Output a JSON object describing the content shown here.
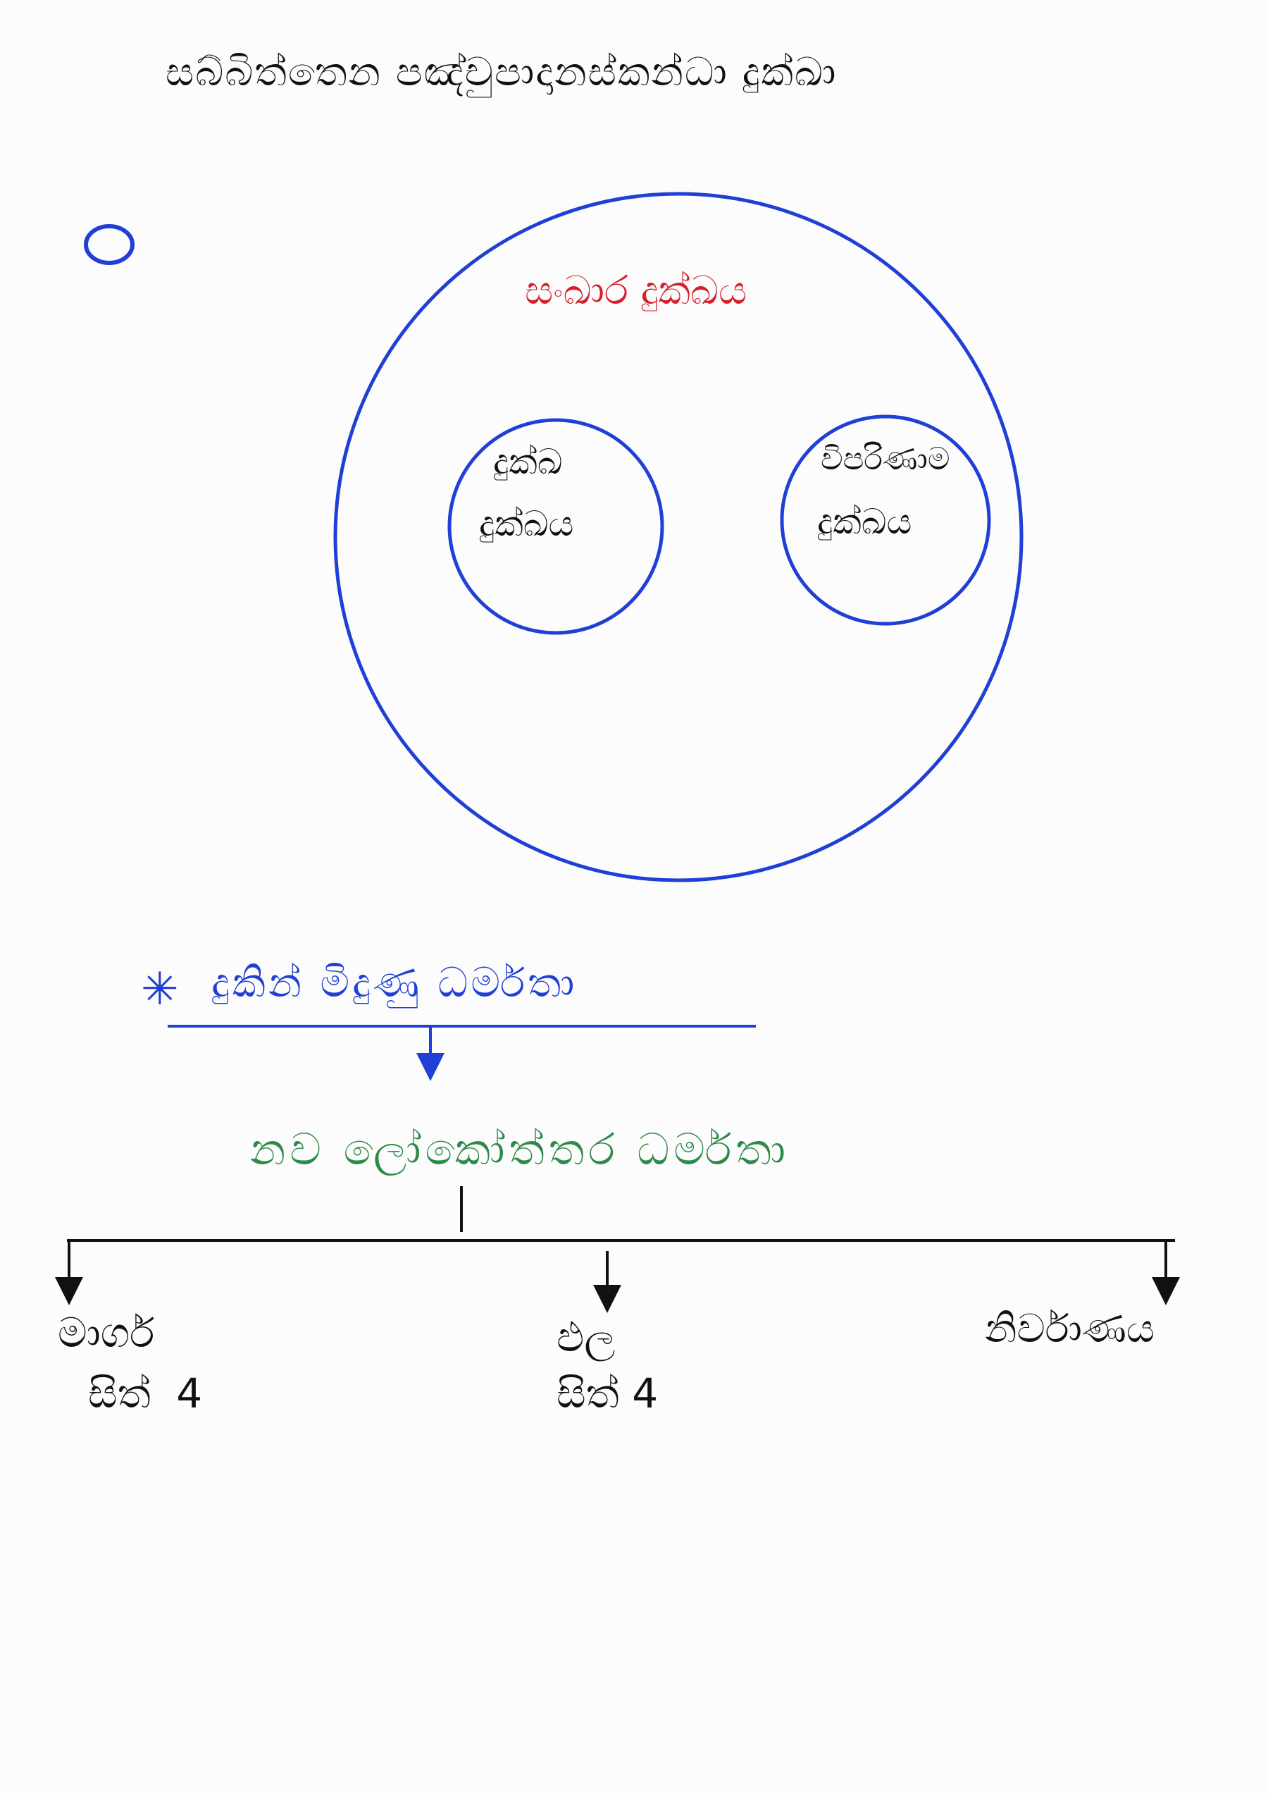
{
  "title": "සබ්බිත්තෙන පඤ්චුපාදානස්කන්ධා දුක්ඛා",
  "marker": "෧",
  "circle_diagram": {
    "outer_label": "සංඛාර දුක්ඛය",
    "left_inner": {
      "line1": "දුක්ඛ",
      "line2": "දුක්ඛය"
    },
    "right_inner": {
      "line1": "විපරිණාම",
      "line2": "දුක්ඛය"
    }
  },
  "section": {
    "star": "✳",
    "heading": "දුකින් මිදුණු ධර්මතා",
    "subheading": "නව ලෝකෝත්තර ධර්මතා"
  },
  "branches": [
    {
      "line1": "මාර්ග",
      "line2": "සිත් 4"
    },
    {
      "line1": "ඵල",
      "line2": "සිත් 4"
    },
    {
      "line1": "නිර්වාණය",
      "line2": ""
    }
  ],
  "colors": {
    "black": "#111111",
    "blue": "#1f3fd6",
    "red": "#d61f2a",
    "green": "#2e8a4a"
  }
}
